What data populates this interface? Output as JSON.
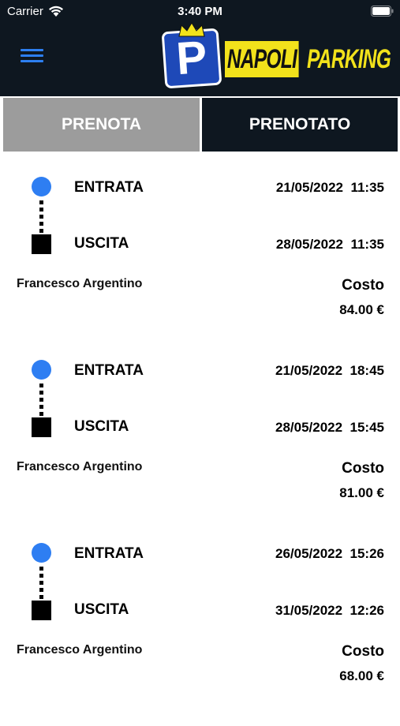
{
  "status_bar": {
    "carrier": "Carrier",
    "time": "3:40 PM"
  },
  "header": {
    "menu_icon": "hamburger-menu-icon",
    "logo": {
      "badge_letter": "P",
      "text_part1": "NAPOLI",
      "text_part2": "PARKING",
      "colors": {
        "badge": "#1e49b8",
        "text": "#f2e21b",
        "background": "#0e1720"
      }
    }
  },
  "tabs": [
    {
      "label": "PRENOTA",
      "selected": false
    },
    {
      "label": "PRENOTATO",
      "selected": true
    }
  ],
  "bookings": [
    {
      "entry_label": "ENTRATA",
      "entry_datetime": "21/05/2022  11:35",
      "exit_label": "USCITA",
      "exit_datetime": "28/05/2022  11:35",
      "name": "Francesco Argentino",
      "cost_label": "Costo",
      "cost_value": "84.00 €"
    },
    {
      "entry_label": "ENTRATA",
      "entry_datetime": "21/05/2022  18:45",
      "exit_label": "USCITA",
      "exit_datetime": "28/05/2022  15:45",
      "name": "Francesco Argentino",
      "cost_label": "Costo",
      "cost_value": "81.00 €"
    },
    {
      "entry_label": "ENTRATA",
      "entry_datetime": "26/05/2022  15:26",
      "exit_label": "USCITA",
      "exit_datetime": "31/05/2022  12:26",
      "name": "Francesco Argentino",
      "cost_label": "Costo",
      "cost_value": "68.00 €"
    }
  ],
  "colors": {
    "accent_blue": "#2e7ef2",
    "tab_inactive": "#9c9c9c",
    "tab_active": "#0e1720"
  }
}
